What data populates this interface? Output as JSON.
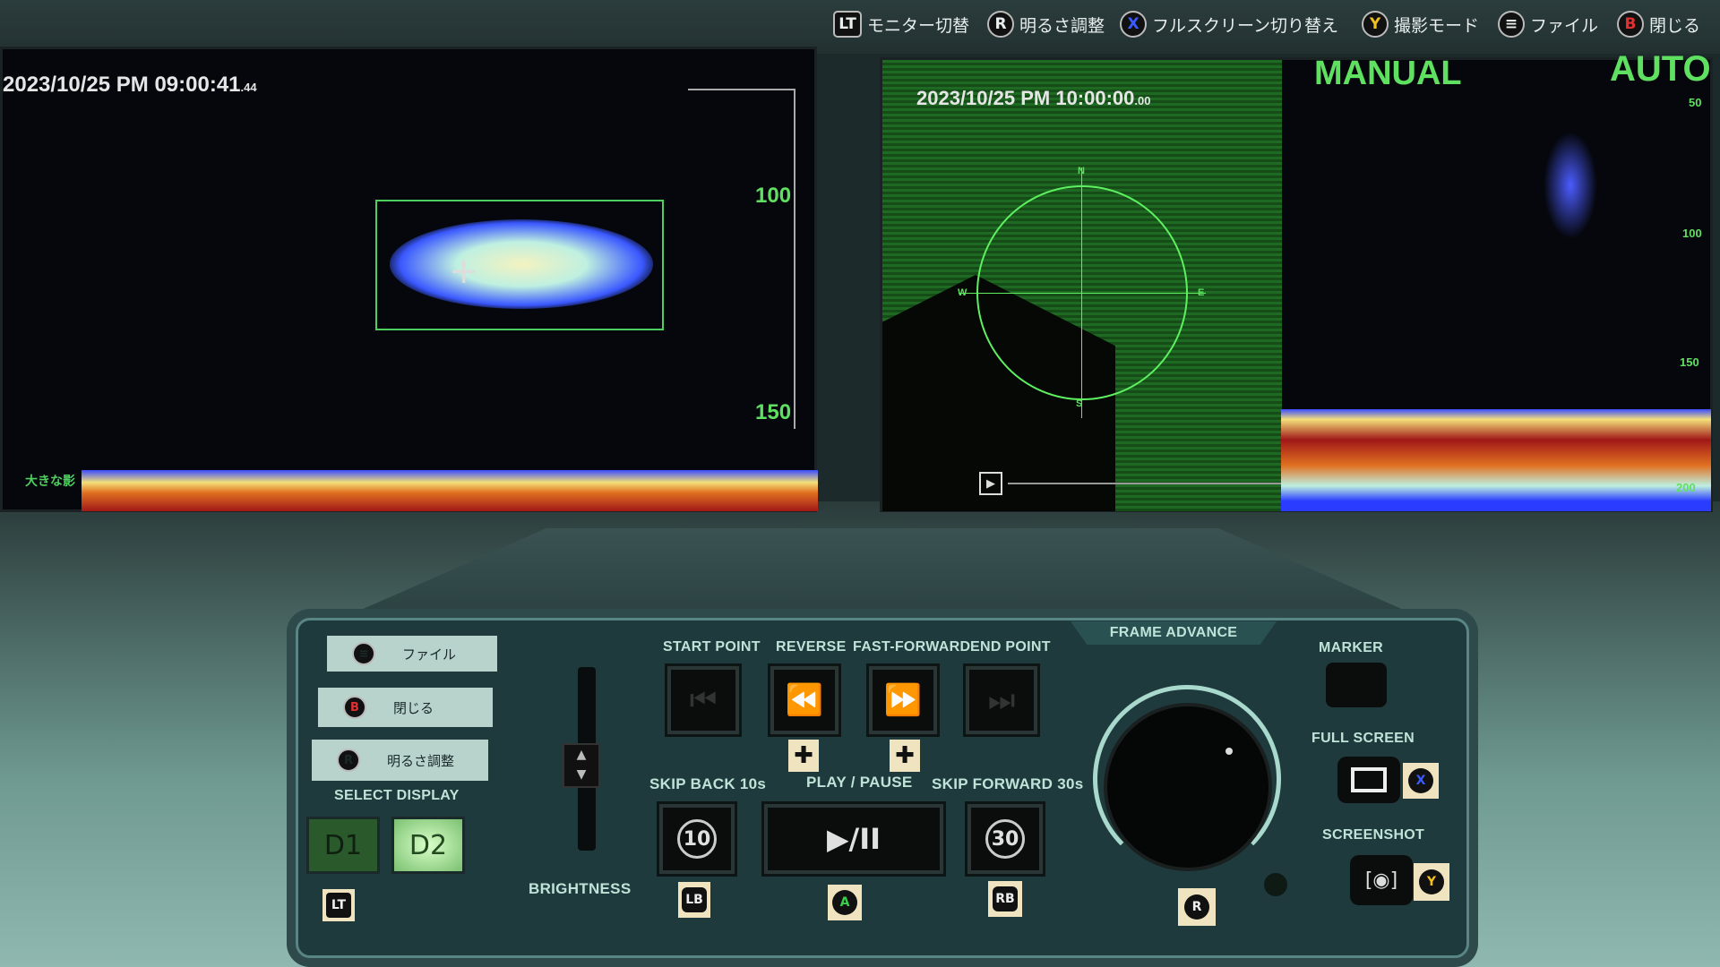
{
  "hints": [
    {
      "key": "LT",
      "label": "モニター切替",
      "color": "#ffffff"
    },
    {
      "key": "R",
      "label": "明るさ調整",
      "color": "#ffffff"
    },
    {
      "key": "X",
      "label": "フルスクリーン切り替え",
      "color": "#3a5cff"
    },
    {
      "key": "Y",
      "label": "撮影モード",
      "color": "#f0c020"
    },
    {
      "key": "≡",
      "label": "ファイル",
      "color": "#ffffff"
    },
    {
      "key": "B",
      "label": "閉じる",
      "color": "#e03030"
    }
  ],
  "monitor1": {
    "timestamp": "2023/10/25 PM 09:00:41",
    "timestamp_fraction": ".44",
    "depth_labels": [
      "100",
      "150"
    ],
    "target_label": "大きな影"
  },
  "monitor2": {
    "timestamp": "2023/10/25 PM 10:00:00",
    "timestamp_fraction": ".00",
    "mode_manual": "MANUAL",
    "mode_auto": "AUTO",
    "depth_labels": [
      "50",
      "100",
      "150",
      "200"
    ],
    "compass": [
      "N",
      "E",
      "S",
      "W"
    ]
  },
  "console": {
    "side": {
      "file": "ファイル",
      "close": "閉じる",
      "brightness": "明るさ調整",
      "select_display": "SELECT DISPLAY",
      "d1": "D1",
      "d2": "D2",
      "lt": "LT"
    },
    "brightness_label": "BRIGHTNESS",
    "start_point": "START POINT",
    "reverse": "REVERSE",
    "fast_forward": "FAST-FORWARD",
    "end_point": "END POINT",
    "skip_back": "SKIP BACK 10s",
    "play_pause": "PLAY / PAUSE",
    "skip_forward": "SKIP FORWARD 30s",
    "skip_back_glyph": "10",
    "skip_forward_glyph": "30",
    "play_glyph": "▶/II",
    "lb": "LB",
    "a": "A",
    "rb": "RB",
    "r": "R",
    "x": "X",
    "y": "Y",
    "frame_advance": "FRAME ADVANCE",
    "marker": "MARKER",
    "full_screen": "FULL SCREEN",
    "screenshot": "SCREENSHOT",
    "selected_display": "D2"
  }
}
